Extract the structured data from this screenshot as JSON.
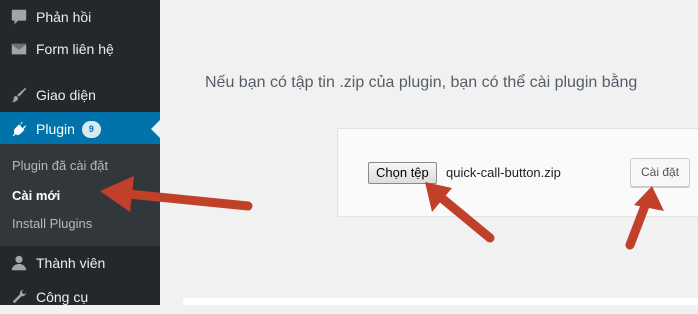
{
  "sidebar": {
    "items": [
      {
        "label": "Phản hồi",
        "icon": "comment-icon"
      },
      {
        "label": "Form liên hệ",
        "icon": "envelope-icon"
      },
      {
        "label": "Giao diện",
        "icon": "paintbrush-icon"
      },
      {
        "label": "Plugin",
        "icon": "plug-icon",
        "badge": "9",
        "active": true
      },
      {
        "label": "Thành viên",
        "icon": "user-icon"
      },
      {
        "label": "Công cụ",
        "icon": "wrench-icon"
      }
    ],
    "submenu": [
      {
        "label": "Plugin đã cài đặt"
      },
      {
        "label": "Cài mới",
        "current": true
      },
      {
        "label": "Install Plugins"
      }
    ]
  },
  "main": {
    "intro_text": "Nếu bạn có tập tin .zip của plugin, bạn có thể cài plugin bằng",
    "upload": {
      "choose_file_label": "Chọn tệp",
      "file_name": "quick-call-button.zip",
      "install_label": "Cài đặt"
    }
  },
  "colors": {
    "sidebar_bg": "#23282d",
    "submenu_bg": "#32373c",
    "active_bg": "#0073aa",
    "annotation_arrow": "#c0402a"
  }
}
